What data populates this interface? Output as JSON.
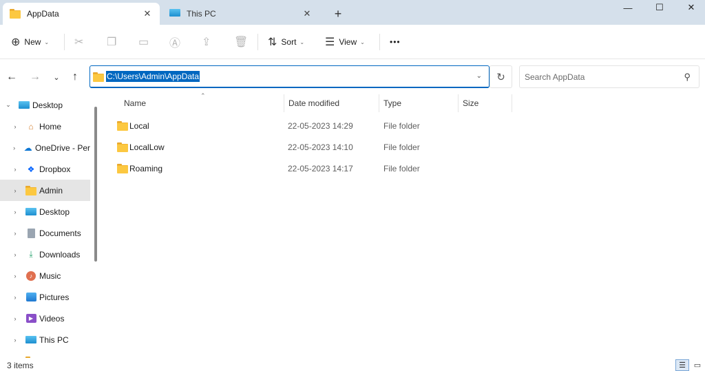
{
  "tabs": [
    {
      "label": "AppData",
      "icon": "folder-icon",
      "active": true
    },
    {
      "label": "This PC",
      "icon": "monitor-icon",
      "active": false
    }
  ],
  "toolbar": {
    "new_label": "New",
    "sort_label": "Sort",
    "view_label": "View",
    "more_label": "•••"
  },
  "address": {
    "path": "C:\\Users\\Admin\\AppData"
  },
  "search": {
    "placeholder": "Search AppData"
  },
  "sidebar": {
    "items": [
      {
        "label": "Desktop",
        "icon": "desktop-icon",
        "expanded": true
      },
      {
        "label": "Home",
        "icon": "home-icon"
      },
      {
        "label": "OneDrive - Per",
        "icon": "onedrive-icon"
      },
      {
        "label": "Dropbox",
        "icon": "dropbox-icon"
      },
      {
        "label": "Admin",
        "icon": "folder-icon",
        "selected": true
      },
      {
        "label": "Desktop",
        "icon": "desktop-icon"
      },
      {
        "label": "Documents",
        "icon": "documents-icon"
      },
      {
        "label": "Downloads",
        "icon": "downloads-icon"
      },
      {
        "label": "Music",
        "icon": "music-icon"
      },
      {
        "label": "Pictures",
        "icon": "pictures-icon"
      },
      {
        "label": "Videos",
        "icon": "videos-icon"
      },
      {
        "label": "This PC",
        "icon": "this-pc-icon"
      }
    ]
  },
  "columns": {
    "name": "Name",
    "date": "Date modified",
    "type": "Type",
    "size": "Size"
  },
  "files": [
    {
      "name": "Local",
      "date": "22-05-2023 14:29",
      "type": "File folder",
      "size": ""
    },
    {
      "name": "LocalLow",
      "date": "22-05-2023 14:10",
      "type": "File folder",
      "size": ""
    },
    {
      "name": "Roaming",
      "date": "22-05-2023 14:17",
      "type": "File folder",
      "size": ""
    }
  ],
  "status": {
    "item_count": "3 items"
  },
  "colors": {
    "accent": "#0067c0",
    "titlebar": "#d5e0eb",
    "selected": "#e5e5e5",
    "folder": "#fcc841"
  }
}
